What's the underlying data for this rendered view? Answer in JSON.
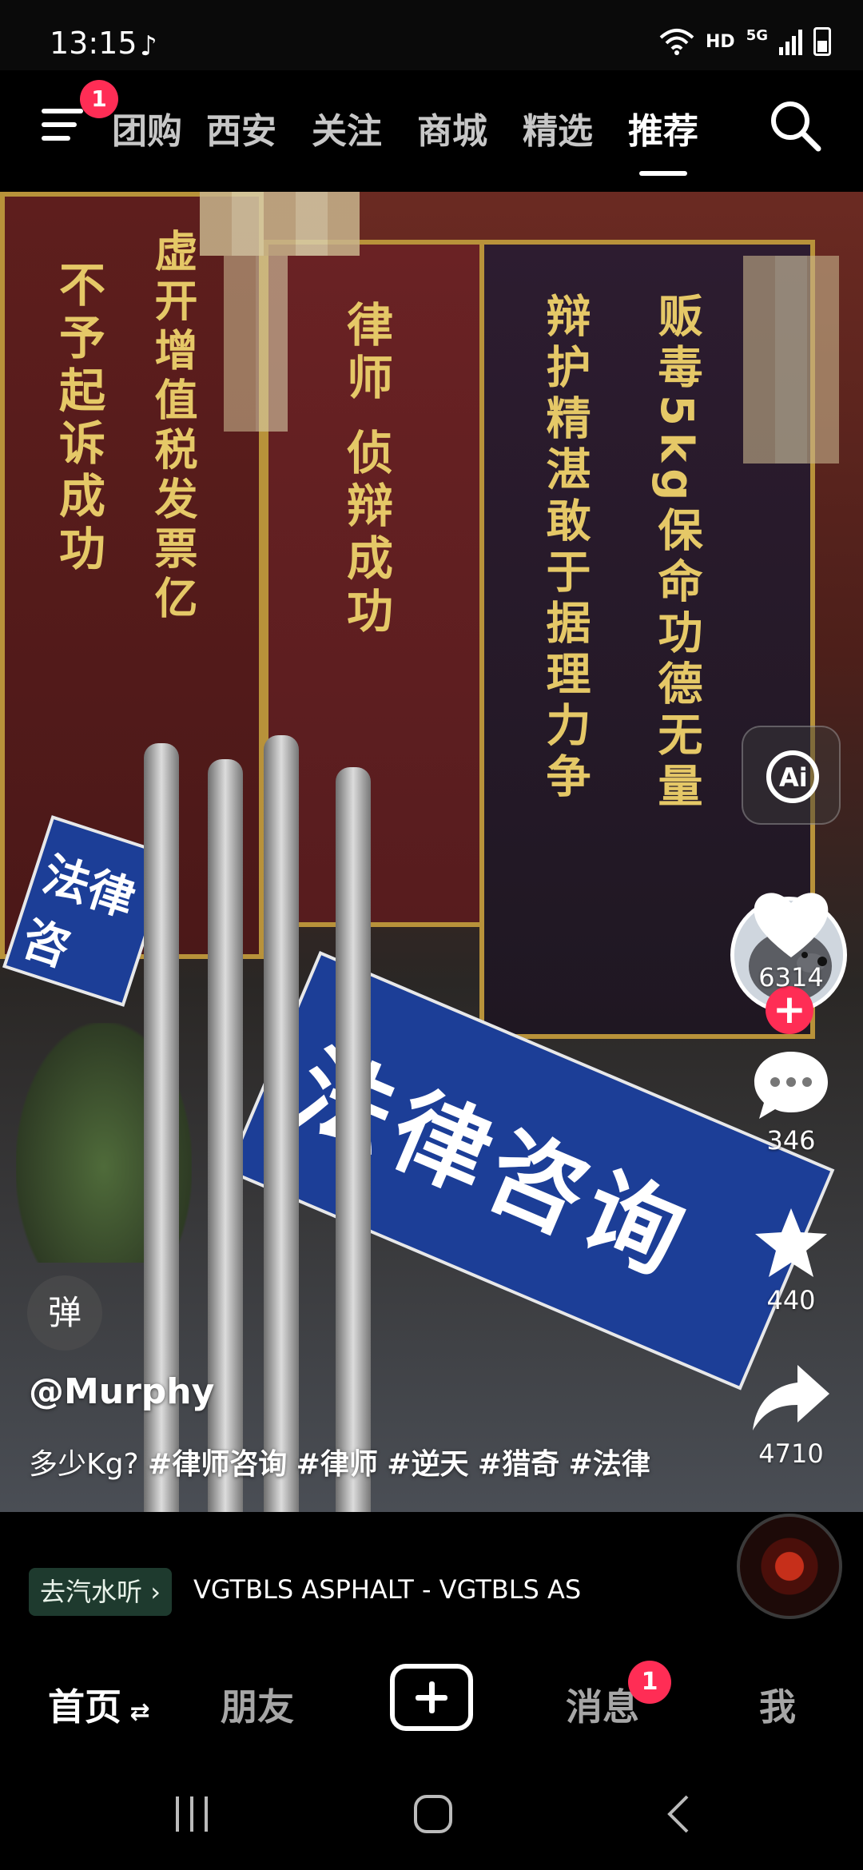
{
  "status": {
    "time": "13:15",
    "network": "HD",
    "cell": "5G"
  },
  "top_nav": {
    "menu_badge": "1",
    "tabs": [
      "团购",
      "西安",
      "关注",
      "商城",
      "精选",
      "推荐"
    ]
  },
  "video": {
    "banner_left_text": "不予起诉成功",
    "banner_left2_text": "虚开增值税发票亿",
    "banner_mid_text": "律师 侦辩成功",
    "banner_right_text1": "贩毒5kg保命功德无量",
    "banner_right_text2": "辩护精湛敢于据理力争",
    "sign_text": "法律咨询",
    "sign_small_text": "法律咨"
  },
  "actions": {
    "likes": "6314",
    "comments": "346",
    "favorites": "440",
    "shares": "4710"
  },
  "post": {
    "danmu_label": "弹",
    "author": "@Murphy",
    "caption_text": "多少Kg?",
    "hashtags": [
      "#律师咨询",
      "#律师",
      "#逆天",
      "#猎奇",
      "#法律"
    ]
  },
  "music": {
    "chip_label": "去汽水听",
    "title": "VGTBLS    ASPHALT - VGTBLS    AS"
  },
  "bottom_nav": {
    "home": "首页",
    "friends": "朋友",
    "messages": "消息",
    "messages_badge": "1",
    "me": "我"
  },
  "colors": {
    "accent": "#ff2d55",
    "chip_bg": "#1e3a2e",
    "sign_blue": "#1c3e97"
  },
  "icons": {
    "menu": "menu-icon",
    "search": "search-icon",
    "ai": "ai-icon",
    "like": "heart-icon",
    "comment": "comment-icon",
    "favorite": "star-icon",
    "share": "share-icon",
    "create": "plus-icon",
    "tiktok": "tiktok-icon"
  }
}
